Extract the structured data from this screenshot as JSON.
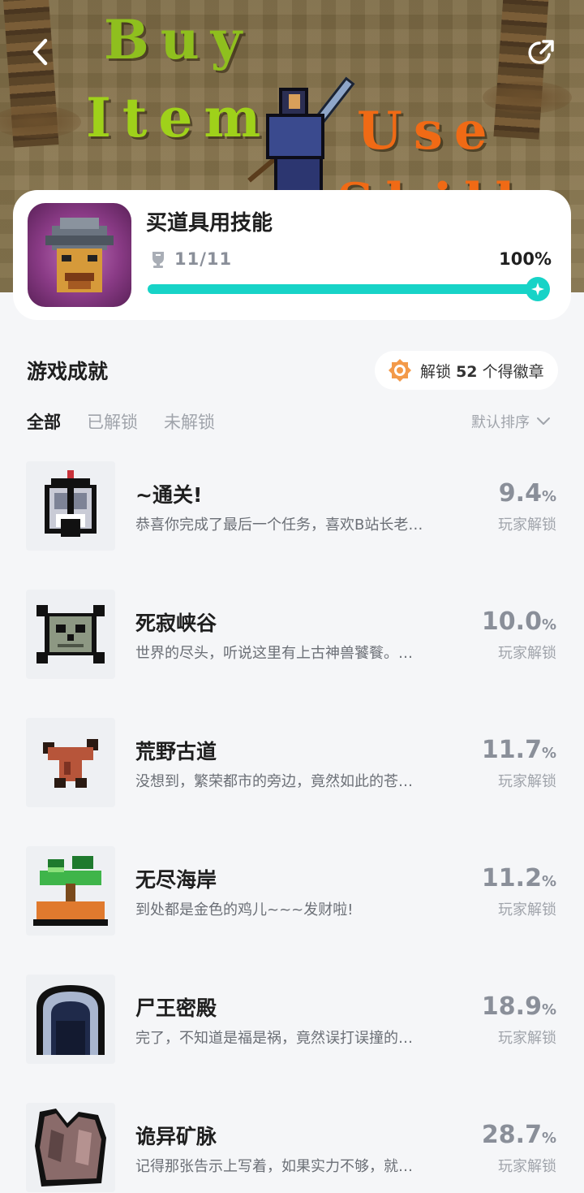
{
  "banner": {
    "word_buy": "Buy",
    "word_item": "Item",
    "word_use": "Use",
    "word_skill": "Skill"
  },
  "header": {
    "game_title": "买道具用技能",
    "progress_text": "11/11",
    "progress_percent": "100%",
    "progress_fraction": 1.0
  },
  "section": {
    "title": "游戏成就",
    "badge_prefix": "解锁",
    "badge_count": "52",
    "badge_suffix": "个得徽章"
  },
  "tabs": [
    {
      "label": "全部",
      "active": true
    },
    {
      "label": "已解锁",
      "active": false
    },
    {
      "label": "未解锁",
      "active": false
    }
  ],
  "sort": {
    "label": "默认排序"
  },
  "achievements": [
    {
      "name": "~通关!",
      "desc": "恭喜你完成了最后一个任务，喜欢B站长老…",
      "pct": "9.4",
      "unit": "%",
      "sub": "玩家解锁",
      "icon": "helmet-icon"
    },
    {
      "name": "死寂峡谷",
      "desc": "世界的尽头，听说这里有上古神兽饕餮。…",
      "pct": "10.0",
      "unit": "%",
      "sub": "玩家解锁",
      "icon": "skull-crossbones-icon"
    },
    {
      "name": "荒野古道",
      "desc": "没想到，繁荣都市的旁边，竟然如此的苍…",
      "pct": "11.7",
      "unit": "%",
      "sub": "玩家解锁",
      "icon": "dead-tree-icon"
    },
    {
      "name": "无尽海岸",
      "desc": "到处都是金色的鸡儿~~~发财啦!",
      "pct": "11.2",
      "unit": "%",
      "sub": "玩家解锁",
      "icon": "palm-island-icon"
    },
    {
      "name": "尸王密殿",
      "desc": "完了，不知道是福是祸，竟然误打误撞的…",
      "pct": "18.9",
      "unit": "%",
      "sub": "玩家解锁",
      "icon": "cave-entrance-icon"
    },
    {
      "name": "诡异矿脉",
      "desc": "记得那张告示上写着，如果实力不够，就…",
      "pct": "28.7",
      "unit": "%",
      "sub": "玩家解锁",
      "icon": "ore-rock-icon"
    }
  ]
}
